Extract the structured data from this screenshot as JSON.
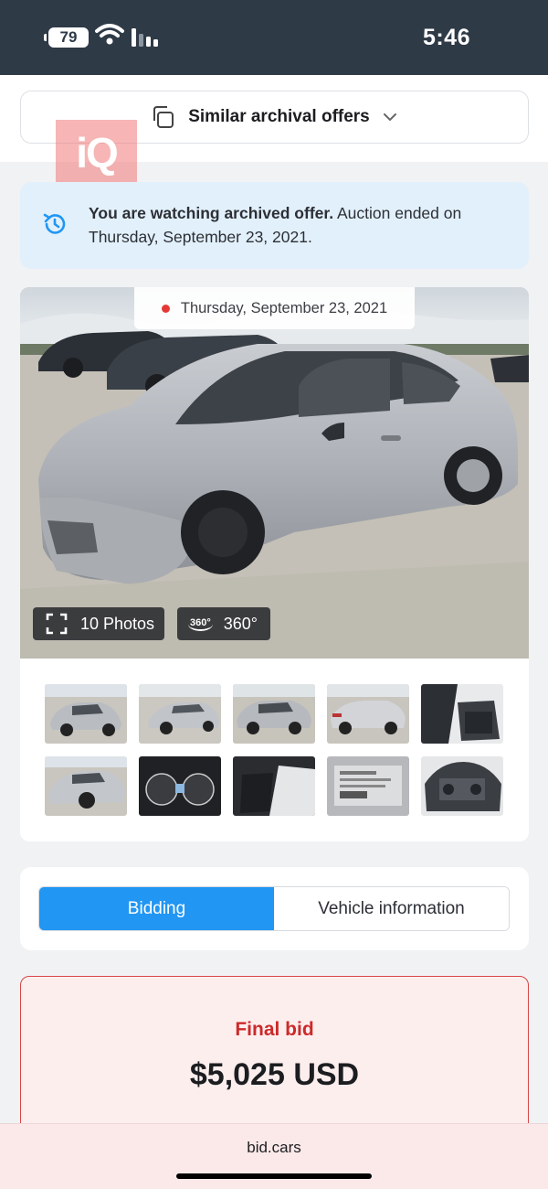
{
  "status_bar": {
    "battery": "79",
    "time": "5:46"
  },
  "similar": {
    "label": "Similar archival offers"
  },
  "watermark": {
    "text": "iQ"
  },
  "notice": {
    "bold": "You are watching archived offer.",
    "text": " Auction ended on Thursday, September 23, 2021."
  },
  "gallery": {
    "date": "Thursday, September 23, 2021",
    "photos_button": "10 Photos",
    "view360_icon_text": "360°",
    "view360_button": "360°"
  },
  "tabs": [
    {
      "label": "Bidding",
      "active": true
    },
    {
      "label": "Vehicle information",
      "active": false
    }
  ],
  "bid": {
    "label": "Final bid",
    "value": "$5,025 USD"
  },
  "browser": {
    "url": "bid.cars"
  },
  "colors": {
    "accent": "#2196f3",
    "danger": "#cc2a2a",
    "status_bar": "#2f3a47"
  }
}
